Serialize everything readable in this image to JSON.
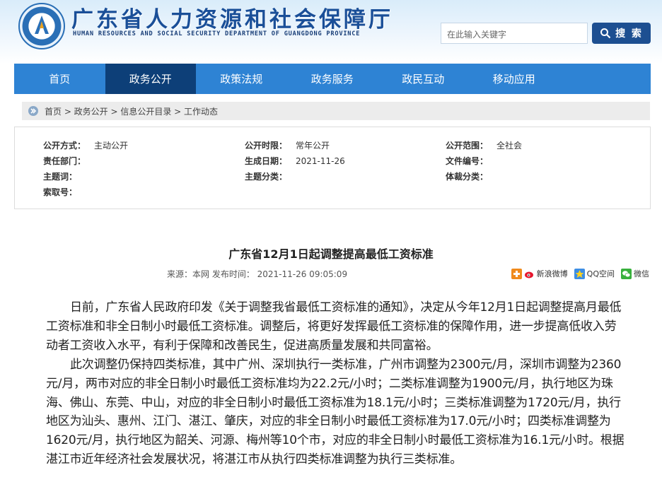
{
  "header": {
    "title": "广东省人力资源和社会保障厅",
    "subtitle": "HUMAN RESOURCES AND SOCIAL SECURITY DEPARTMENT OF GUANGDONG PROVINCE",
    "search_placeholder": "在此输入关键字",
    "search_button": "搜 索"
  },
  "nav": {
    "items": [
      {
        "label": "首页"
      },
      {
        "label": "政务公开",
        "active": true
      },
      {
        "label": "政策法规"
      },
      {
        "label": "政务服务"
      },
      {
        "label": "政民互动"
      },
      {
        "label": "移动应用"
      }
    ]
  },
  "breadcrumb": "首页 > 政务公开 > 信息公开目录 > 工作动态",
  "meta": {
    "public_method_label": "公开方式：",
    "public_method": "主动公开",
    "public_period_label": "公开时限：",
    "public_period": "常年公开",
    "public_scope_label": "公开范围：",
    "public_scope": "全社会",
    "department_label": "责任部门：",
    "department": "",
    "created_label": "生成日期：",
    "created": "2021-11-26",
    "doc_no_label": "文件编号：",
    "doc_no": "",
    "subject_label": "主题词：",
    "subject": "",
    "category_label": "主题分类：",
    "category": "",
    "genre_label": "体裁分类：",
    "genre": "",
    "index_label": "索取号：",
    "index": ""
  },
  "article": {
    "title": "广东省12月1日起调整提高最低工资标准",
    "source_line": "来源：本网   发布时间：  2021-11-26 09:05:09",
    "share": {
      "weibo": "新浪微博",
      "qzone": "QQ空间",
      "wechat": "微信"
    },
    "paragraphs": [
      "日前，广东省人民政府印发《关于调整我省最低工资标准的通知》，决定从今年12月1日起调整提高月最低工资标准和非全日制小时最低工资标准。调整后，将更好发挥最低工资标准的保障作用，进一步提高低收入劳动者工资收入水平，有利于保障和改善民生，促进高质量发展和共同富裕。",
      "此次调整仍保持四类标准，其中广州、深圳执行一类标准，广州市调整为2300元/月，深圳市调整为2360元/月，两市对应的非全日制小时最低工资标准均为22.2元/小时；二类标准调整为1900元/月，执行地区为珠海、佛山、东莞、中山，对应的非全日制小时最低工资标准为18.1元/小时；三类标准调整为1720元/月，执行地区为汕头、惠州、江门、湛江、肇庆，对应的非全日制小时最低工资标准为17.0元/小时；四类标准调整为1620元/月，执行地区为韶关、河源、梅州等10个市，对应的非全日制小时最低工资标准为16.1元/小时。根据湛江市近年经济社会发展状况，将湛江市从执行四类标准调整为执行三类标准。"
    ]
  },
  "colors": {
    "nav_bg": "#2e83d4",
    "nav_active": "#0d3f78",
    "brand": "#1a4f98"
  }
}
